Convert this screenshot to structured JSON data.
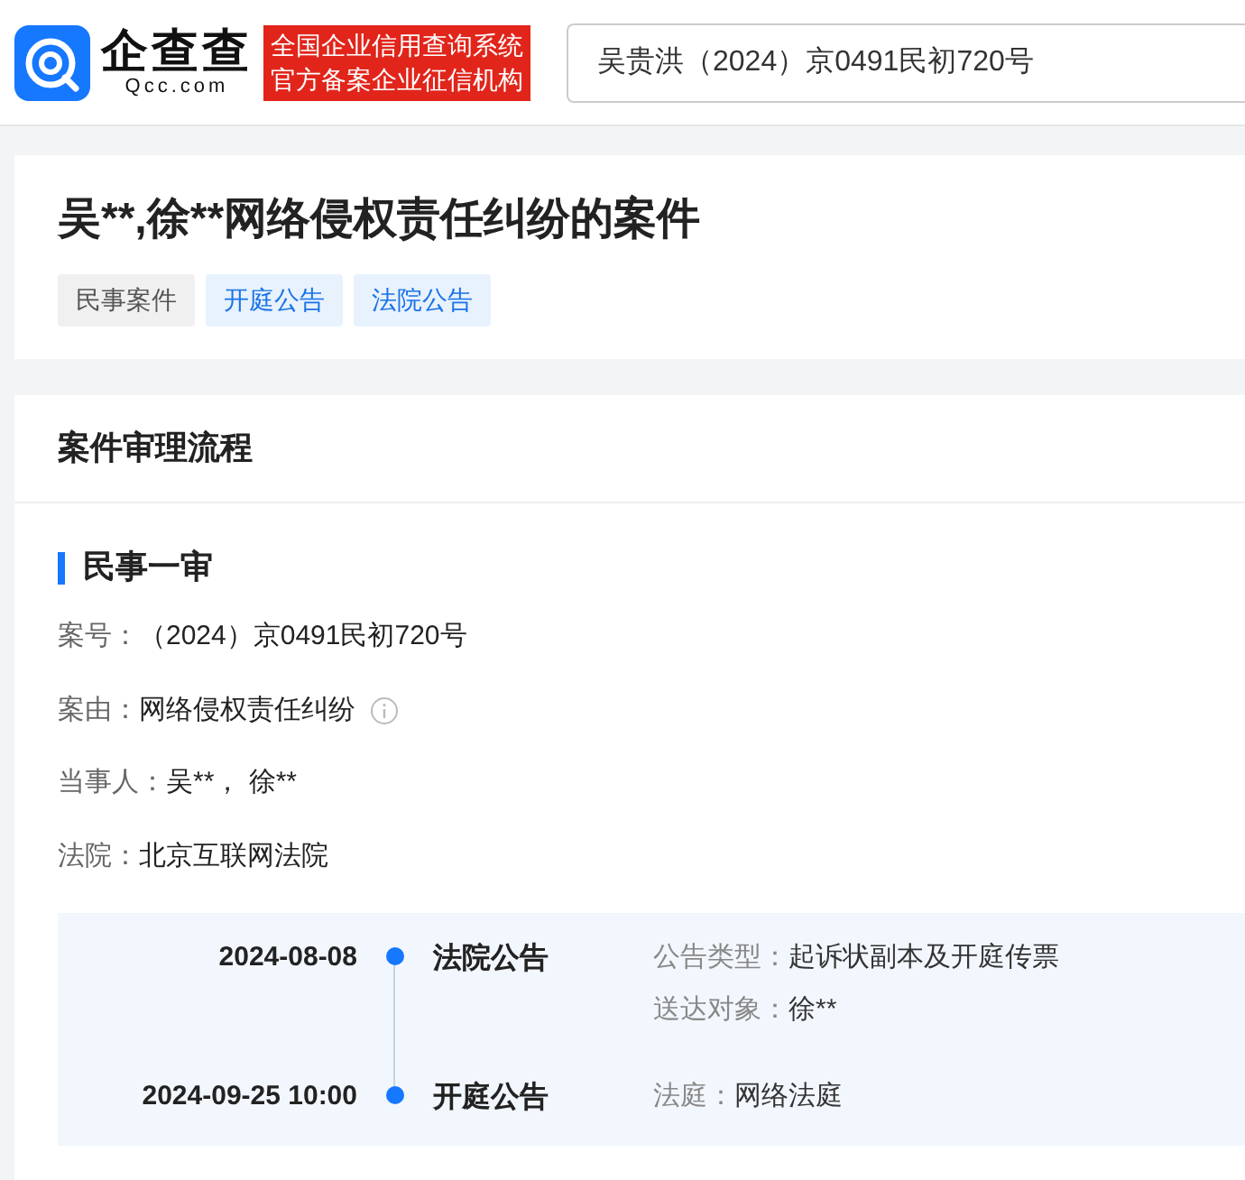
{
  "header": {
    "logo_name": "企查查",
    "logo_domain": "Qcc.com",
    "slogan": [
      "全国企业信用查询系统",
      "官方备案企业征信机构"
    ],
    "search": {
      "value": "吴贵洪（2024）京0491民初720号"
    }
  },
  "case": {
    "title": "吴**,徐**网络侵权责任纠纷的案件",
    "tags": [
      {
        "label": "民事案件",
        "kind": "type"
      },
      {
        "label": "开庭公告",
        "kind": "notice"
      },
      {
        "label": "法院公告",
        "kind": "notice"
      }
    ]
  },
  "process": {
    "heading": "案件审理流程",
    "stage": "民事一审",
    "fields": [
      {
        "label": "案号：",
        "value": "（2024）京0491民初720号",
        "kind": "plain"
      },
      {
        "label": "案由：",
        "value": "网络侵权责任纠纷",
        "kind": "info"
      },
      {
        "label": "当事人：",
        "value": "吴**， 徐**",
        "kind": "plain"
      },
      {
        "label": "法院：",
        "value": "北京互联网法院",
        "kind": "plain"
      }
    ],
    "timeline": [
      {
        "date": "2024-08-08",
        "title": "法院公告",
        "details": [
          {
            "label": "公告类型：",
            "value": "起诉状副本及开庭传票"
          },
          {
            "label": "送达对象：",
            "value": "徐**"
          }
        ]
      },
      {
        "date": "2024-09-25 10:00",
        "title": "开庭公告",
        "details": [
          {
            "label": "法庭：",
            "value": "网络法庭"
          }
        ]
      }
    ]
  }
}
